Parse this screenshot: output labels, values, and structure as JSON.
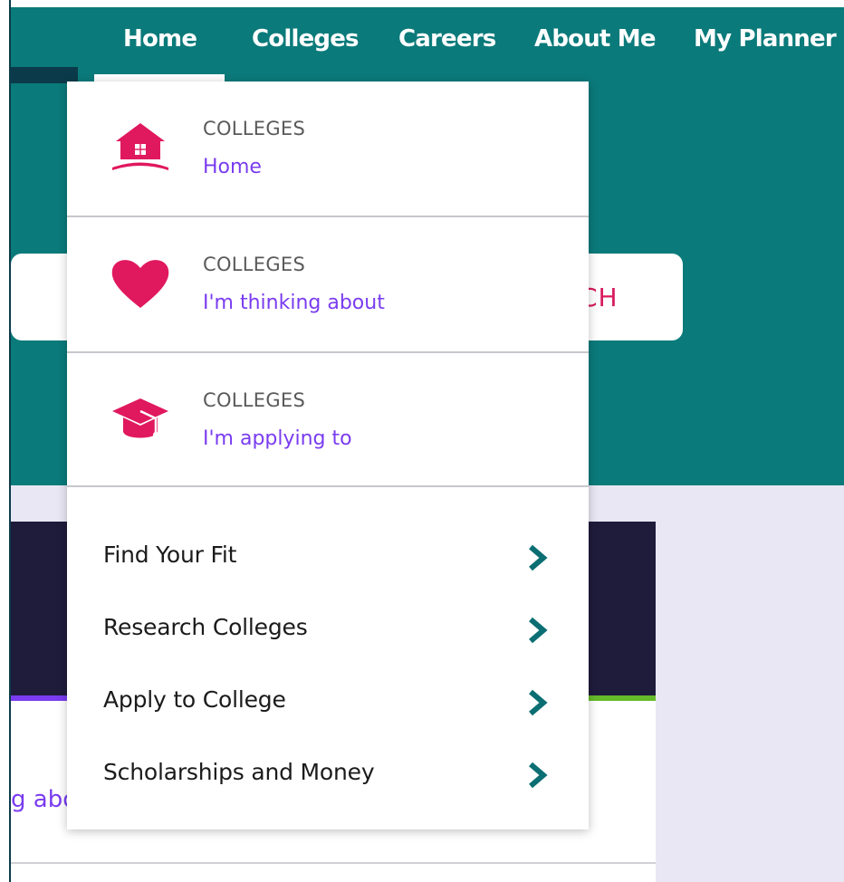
{
  "nav": {
    "items": [
      {
        "label": "Home"
      },
      {
        "label": "Colleges"
      },
      {
        "label": "Careers"
      },
      {
        "label": "About Me"
      },
      {
        "label": "My Planner"
      }
    ],
    "active_index": 0
  },
  "search": {
    "button_partial_label": "CH"
  },
  "background_card": {
    "partial_text": "g about"
  },
  "dropdown": {
    "sections": [
      {
        "kicker": "COLLEGES",
        "title": "Home",
        "icon": "home-icon"
      },
      {
        "kicker": "COLLEGES",
        "title": "I'm thinking about",
        "icon": "heart-icon"
      },
      {
        "kicker": "COLLEGES",
        "title": "I'm applying to",
        "icon": "graduation-cap-icon"
      }
    ],
    "links": [
      {
        "label": "Find Your Fit",
        "icon": "chevron-right-icon"
      },
      {
        "label": "Research Colleges",
        "icon": "chevron-right-icon"
      },
      {
        "label": "Apply to College",
        "icon": "chevron-right-icon"
      },
      {
        "label": "Scholarships and Money",
        "icon": "chevron-right-icon"
      }
    ]
  },
  "colors": {
    "header_teal": "#0b7a7a",
    "accent_pink": "#e0185e",
    "link_purple": "#7a3cf0",
    "chevron_teal": "#0b6e73",
    "dark_panel": "#1f1b3b",
    "green_progress": "#66bb2a"
  }
}
